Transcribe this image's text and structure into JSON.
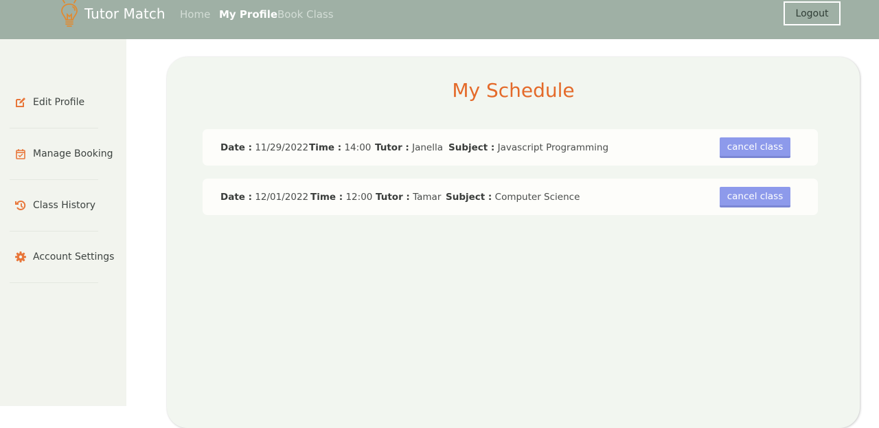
{
  "navbar": {
    "brand_name": "Tutor Match",
    "brand_icon": "lightbulb-icon",
    "links": [
      {
        "label": "Home",
        "active": false
      },
      {
        "label": "My Profile",
        "active": true
      },
      {
        "label": "Book Class",
        "active": false
      }
    ],
    "logout_label": "Logout"
  },
  "sidebar": {
    "items": [
      {
        "label": "Edit Profile",
        "icon": "edit-icon"
      },
      {
        "label": "Manage Booking",
        "icon": "calendar-check-icon"
      },
      {
        "label": "Class History",
        "icon": "history-icon"
      },
      {
        "label": "Account Settings",
        "icon": "gear-icon"
      }
    ]
  },
  "schedule": {
    "title": "My Schedule",
    "labels": {
      "date": "Date :",
      "time": "Time :",
      "tutor": "Tutor :",
      "subject": "Subject :"
    },
    "bookings": [
      {
        "date": "11/29/2022",
        "time": "14:00",
        "tutor": "Janella",
        "subject": "Javascript Programming",
        "action": "cancel class"
      },
      {
        "date": "12/01/2022",
        "time": "12:00",
        "tutor": "Tamar",
        "subject": "Computer Science",
        "action": "cancel class"
      }
    ]
  },
  "colors": {
    "accent": "#e46a2a",
    "navbar": "#9fb0a5",
    "button": "#8d9aeb"
  }
}
